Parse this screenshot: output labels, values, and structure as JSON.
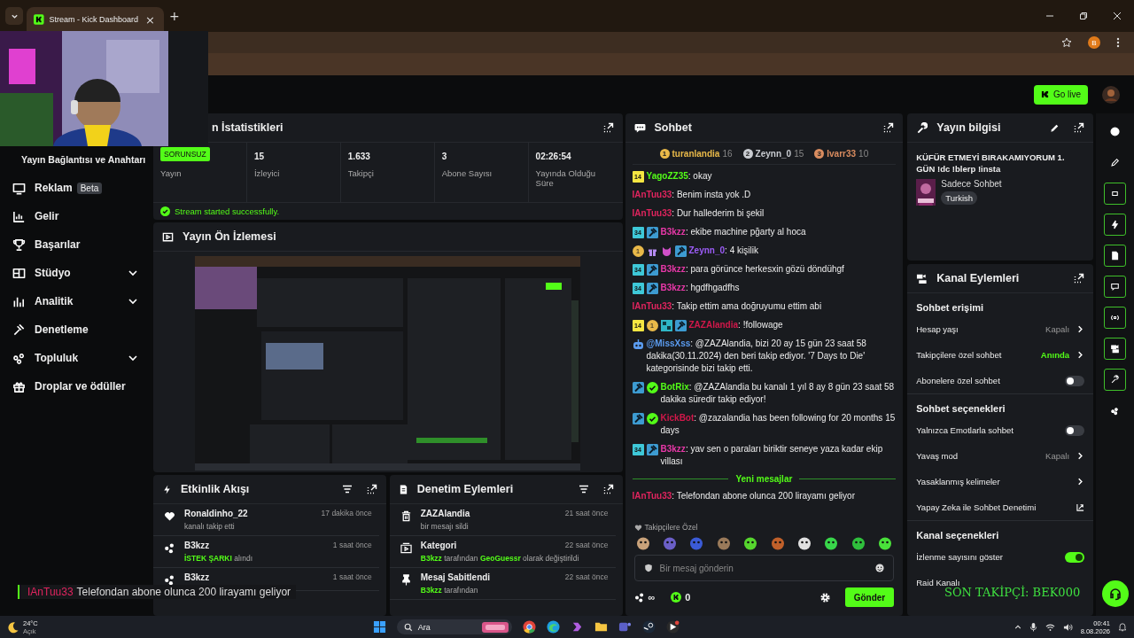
{
  "browser": {
    "tab_title": "Stream - Kick Dashboard",
    "close_glyph": "×",
    "new_tab_glyph": "+",
    "profile_initial": "B"
  },
  "header": {
    "go_live": "Go live"
  },
  "sidebar": {
    "items": [
      {
        "label": "Yayın Bağlantısı ve Anahtarı"
      },
      {
        "label": "Reklam",
        "badge": "Beta",
        "expandable": false
      },
      {
        "label": "Gelir",
        "expandable": false
      },
      {
        "label": "Başarılar",
        "expandable": false
      },
      {
        "label": "Stüdyo",
        "expandable": true
      },
      {
        "label": "Analitik",
        "expandable": true
      },
      {
        "label": "Denetleme",
        "expandable": false
      },
      {
        "label": "Topluluk",
        "expandable": true
      },
      {
        "label": "Droplar ve ödüller",
        "expandable": false
      }
    ]
  },
  "stats": {
    "title": "n İstatistikleri",
    "status": "SORUNSUZ",
    "status_label": "Yayın",
    "metrics": [
      {
        "value": "15",
        "label": "İzleyici"
      },
      {
        "value": "1.633",
        "label": "Takipçi"
      },
      {
        "value": "3",
        "label": "Abone Sayısı"
      },
      {
        "value": "02:26:54",
        "label": "Yayında Olduğu Süre"
      }
    ],
    "message": "Stream started successfully."
  },
  "preview": {
    "title": "Yayın Ön İzlemesi"
  },
  "activity": {
    "title": "Etkinlik Akışı",
    "items": [
      {
        "kind": "follow",
        "name": "Ronaldinho_22",
        "time": "17 dakika önce",
        "detail": [
          {
            "text": "kanalı takip etti",
            "highlight": false
          }
        ]
      },
      {
        "kind": "reward",
        "name": "B3kzz",
        "time": "1 saat önce",
        "detail": [
          {
            "text": "İSTEK ŞARKI",
            "highlight": true
          },
          {
            "text": " alındı",
            "highlight": false
          }
        ]
      },
      {
        "kind": "reward",
        "name": "B3kzz",
        "time": "1 saat önce"
      }
    ]
  },
  "moderation": {
    "title": "Denetim Eylemleri",
    "items": [
      {
        "kind": "delete",
        "name": "ZAZAlandia",
        "time": "21 saat önce",
        "detail": [
          {
            "text": "bir mesajı sildi",
            "highlight": false
          }
        ]
      },
      {
        "kind": "category",
        "name": "Kategori",
        "time": "22 saat önce",
        "detail": [
          {
            "text": "B3kzz",
            "highlight": true
          },
          {
            "text": " tarafından ",
            "highlight": false
          },
          {
            "text": "GeoGuessr",
            "highlight": true
          },
          {
            "text": " olarak değiştirildi",
            "highlight": false
          }
        ]
      },
      {
        "kind": "pin",
        "name": "Mesaj Sabitlendi",
        "time": "22 saat önce",
        "detail": [
          {
            "text": "B3kzz",
            "highlight": true
          },
          {
            "text": " tarafından",
            "highlight": false
          }
        ]
      }
    ]
  },
  "chat": {
    "title": "Sohbet",
    "leaders": [
      {
        "rank": "1",
        "name": "turanlandia",
        "count": "16",
        "color": "#e9b949"
      },
      {
        "rank": "2",
        "name": "Zeynn_0",
        "count": "15",
        "color": "#c9ccd1"
      },
      {
        "rank": "3",
        "name": "Ivarr33",
        "count": "10",
        "color": "#d98c5f"
      }
    ],
    "messages": [
      {
        "badges": [
          {
            "kind": "sub",
            "text": "14",
            "color": "#f5e642"
          }
        ],
        "user": "YagoZZ35",
        "color": "#53fc18",
        "text": ": okay"
      },
      {
        "user": "IAnTuu33",
        "color": "#e0245e",
        "text": ": Benim insta yok .D"
      },
      {
        "user": "IAnTuu33",
        "color": "#e0245e",
        "text": ": Dur hallederim bi şekil"
      },
      {
        "badges": [
          {
            "kind": "sub",
            "text": "34",
            "color": "#3ec8d8"
          },
          {
            "kind": "mod"
          }
        ],
        "user": "B3kzz",
        "color": "#e838a8",
        "text": ": ekibe machine pğarty al hoca"
      },
      {
        "badges": [
          {
            "kind": "rank",
            "text": "1"
          },
          {
            "kind": "gift"
          },
          {
            "kind": "emote"
          },
          {
            "kind": "mod"
          }
        ],
        "user": "Zeynn_0",
        "color": "#9b5cf6",
        "text": ": 4 kişilik"
      },
      {
        "badges": [
          {
            "kind": "sub",
            "text": "34",
            "color": "#3ec8d8"
          },
          {
            "kind": "mod"
          }
        ],
        "user": "B3kzz",
        "color": "#e838a8",
        "text": ": para görünce herkesxin gözü döndühgf"
      },
      {
        "badges": [
          {
            "kind": "sub",
            "text": "34",
            "color": "#3ec8d8"
          },
          {
            "kind": "mod"
          }
        ],
        "user": "B3kzz",
        "color": "#e838a8",
        "text": ": hgdfhgadfhs"
      },
      {
        "user": "IAnTuu33",
        "color": "#e0245e",
        "text": ": Takip ettim ama doğruyumu ettim abi"
      },
      {
        "badges": [
          {
            "kind": "sub",
            "text": "14",
            "color": "#f5e642"
          },
          {
            "kind": "rank",
            "text": "1"
          },
          {
            "kind": "og"
          },
          {
            "kind": "mod"
          }
        ],
        "user": "ZAZAlandia",
        "color": "#d1184a",
        "text": ": !followage"
      },
      {
        "badges": [
          {
            "kind": "bot"
          }
        ],
        "user": "@MissXss",
        "color": "#5b9cf0",
        "text": ": @ZAZAlandia, bizi 20 ay 15 gün 23 saat 58 dakika(30.11.2024) den beri takip ediyor. '7 Days to Die' kategorisinde bizi takip etti."
      },
      {
        "badges": [
          {
            "kind": "mod"
          },
          {
            "kind": "verified"
          }
        ],
        "user": "BotRix",
        "color": "#53fc18",
        "text": ": @ZAZAlandia bu kanalı 1 yıl 8 ay 8 gün 23 saat 58 dakika süredir takip ediyor!"
      },
      {
        "badges": [
          {
            "kind": "mod"
          },
          {
            "kind": "verified"
          }
        ],
        "user": "KickBot",
        "color": "#d1184a",
        "text": ": @zazalandia has been following for 20 months 15 days"
      },
      {
        "badges": [
          {
            "kind": "sub",
            "text": "34",
            "color": "#3ec8d8"
          },
          {
            "kind": "mod"
          }
        ],
        "user": "B3kzz",
        "color": "#e838a8",
        "text": ": yav sen o paraları biriktir seneye yaza kadar ekip villası"
      }
    ],
    "new_divider": "Yeni mesajlar",
    "new_messages": [
      {
        "user": "IAnTuu33",
        "color": "#e0245e",
        "text": ": Telefondan abone olunca 200 lirayamı geliyor"
      }
    ],
    "emote_section": "Takipçilere Özel",
    "placeholder": "Bir mesaj gönderin",
    "points": "∞",
    "kicks": "0",
    "send": "Gönder"
  },
  "stream_info": {
    "title": "Yayın bilgisi",
    "stream_title": "KÜFÜR ETMEYİ BIRAKAMIYORUM 1. GÜN !dc !blerp !insta",
    "category": "Sadece Sohbet",
    "tags": [
      "Turkish"
    ]
  },
  "channel_actions": {
    "title": "Kanal Eylemleri",
    "sections": [
      {
        "heading": "Sohbet erişimi",
        "rows": [
          {
            "kind": "link",
            "label": "Hesap yaşı",
            "value": "Kapalı",
            "highlight": false
          },
          {
            "kind": "link",
            "label": "Takipçilere özel sohbet",
            "value": "Anında",
            "highlight": true
          },
          {
            "kind": "toggle",
            "label": "Abonelere özel sohbet",
            "on": false
          }
        ]
      },
      {
        "heading": "Sohbet seçenekleri",
        "rows": [
          {
            "kind": "toggle",
            "label": "Yalnızca Emotlarla sohbet",
            "on": false
          },
          {
            "kind": "link",
            "label": "Yavaş mod",
            "value": "Kapalı",
            "highlight": false
          },
          {
            "kind": "link",
            "label": "Yasaklanmış kelimeler"
          },
          {
            "kind": "external",
            "label": "Yapay Zeka ile Sohbet Denetimi"
          }
        ]
      },
      {
        "heading": "Kanal seçenekleri",
        "rows": [
          {
            "kind": "toggle",
            "label": "İzlenme sayısını göster",
            "on": true
          },
          {
            "kind": "plain",
            "label": "Raid Kanalı"
          }
        ]
      }
    ]
  },
  "rail": {
    "items": [
      {
        "active": false
      },
      {
        "active": false
      },
      {
        "active": true
      },
      {
        "active": true
      },
      {
        "active": true
      },
      {
        "active": true
      },
      {
        "active": true
      },
      {
        "active": true
      },
      {
        "active": true
      },
      {
        "active": false
      }
    ]
  },
  "overlay": {
    "chat_user": "IAnTuu33",
    "chat_text": "Telefondan abone olunca 200 lirayamı geliyor",
    "last_follower": "SON TAKİPÇİ: BEK000"
  },
  "taskbar": {
    "temperature": "24°C",
    "weather": "Açık",
    "search": "Ara",
    "time": "00:41",
    "date": "8.08.2026"
  }
}
